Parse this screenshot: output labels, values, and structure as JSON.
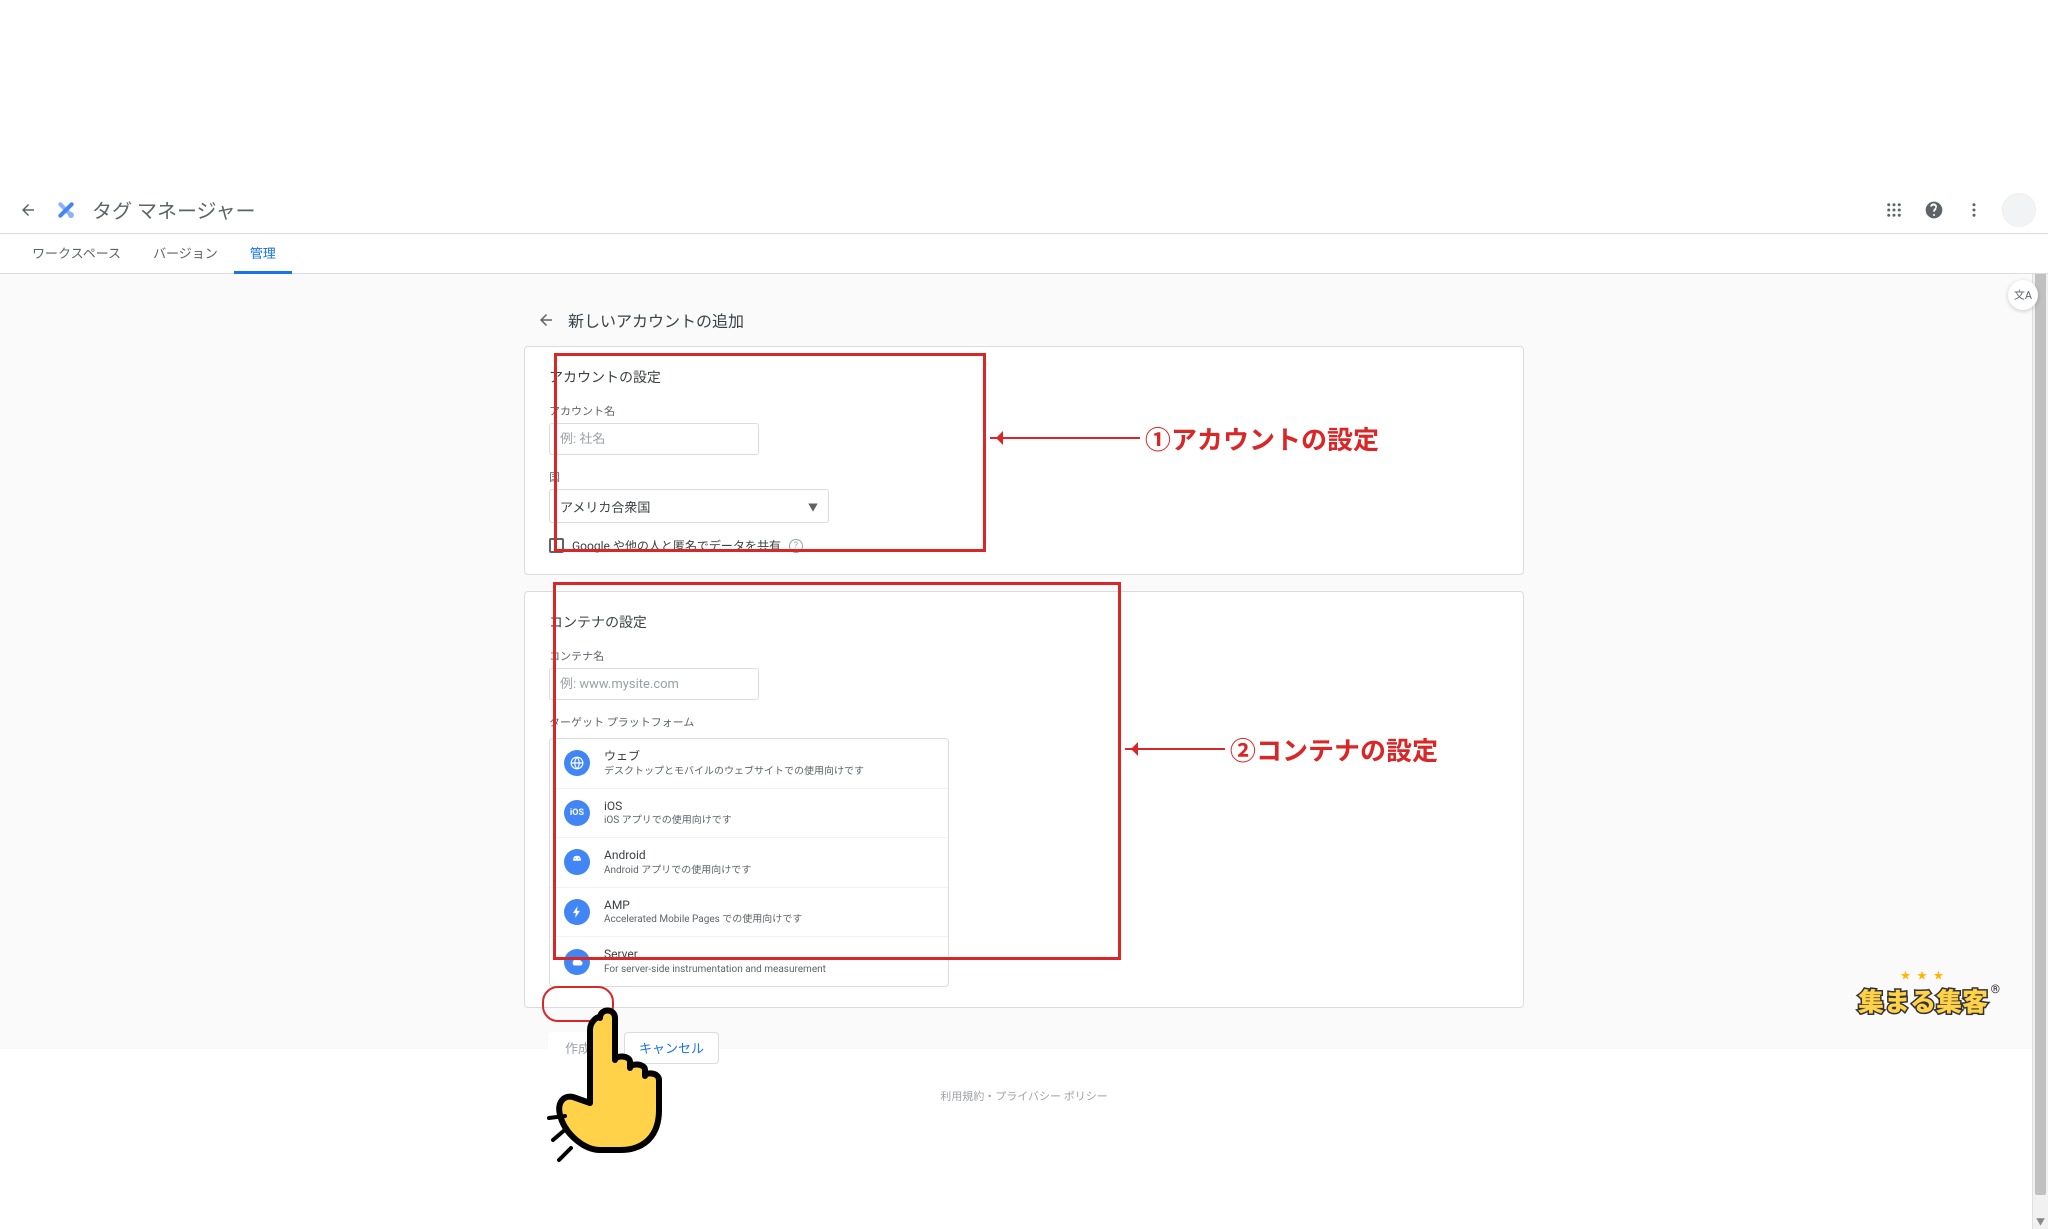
{
  "header": {
    "title": "タグ マネージャー"
  },
  "tabs": {
    "workspace": "ワークスペース",
    "version": "バージョン",
    "admin": "管理"
  },
  "translate_fab": "文A",
  "panel": {
    "title": "新しいアカウントの追加"
  },
  "account_section": {
    "title": "アカウントの設定",
    "name_label": "アカウント名",
    "name_placeholder": "例: 社名",
    "country_label": "国",
    "country_value": "アメリカ合衆国",
    "share_checkbox": "Google や他の人と匿名でデータを共有"
  },
  "container_section": {
    "title": "コンテナの設定",
    "name_label": "コンテナ名",
    "name_placeholder": "例: www.mysite.com",
    "platform_label": "ターゲット プラットフォーム",
    "platforms": [
      {
        "title": "ウェブ",
        "desc": "デスクトップとモバイルのウェブサイトでの使用向けです"
      },
      {
        "title": "iOS",
        "desc": "iOS アプリでの使用向けです"
      },
      {
        "title": "Android",
        "desc": "Android アプリでの使用向けです"
      },
      {
        "title": "AMP",
        "desc": "Accelerated Mobile Pages での使用向けです"
      },
      {
        "title": "Server",
        "desc": "For server-side instrumentation and measurement"
      }
    ]
  },
  "annotations": {
    "a1": "①アカウントの設定",
    "a2": "②コンテナの設定"
  },
  "buttons": {
    "create": "作成",
    "cancel": "キャンセル"
  },
  "footer_legal": "利用規約・プライバシー ポリシー",
  "brand": {
    "text": "集まる集客",
    "stars": "★ ★ ★",
    "reg": "®"
  },
  "colors": {
    "accent": "#1a73e8",
    "annotation": "#d92626"
  }
}
